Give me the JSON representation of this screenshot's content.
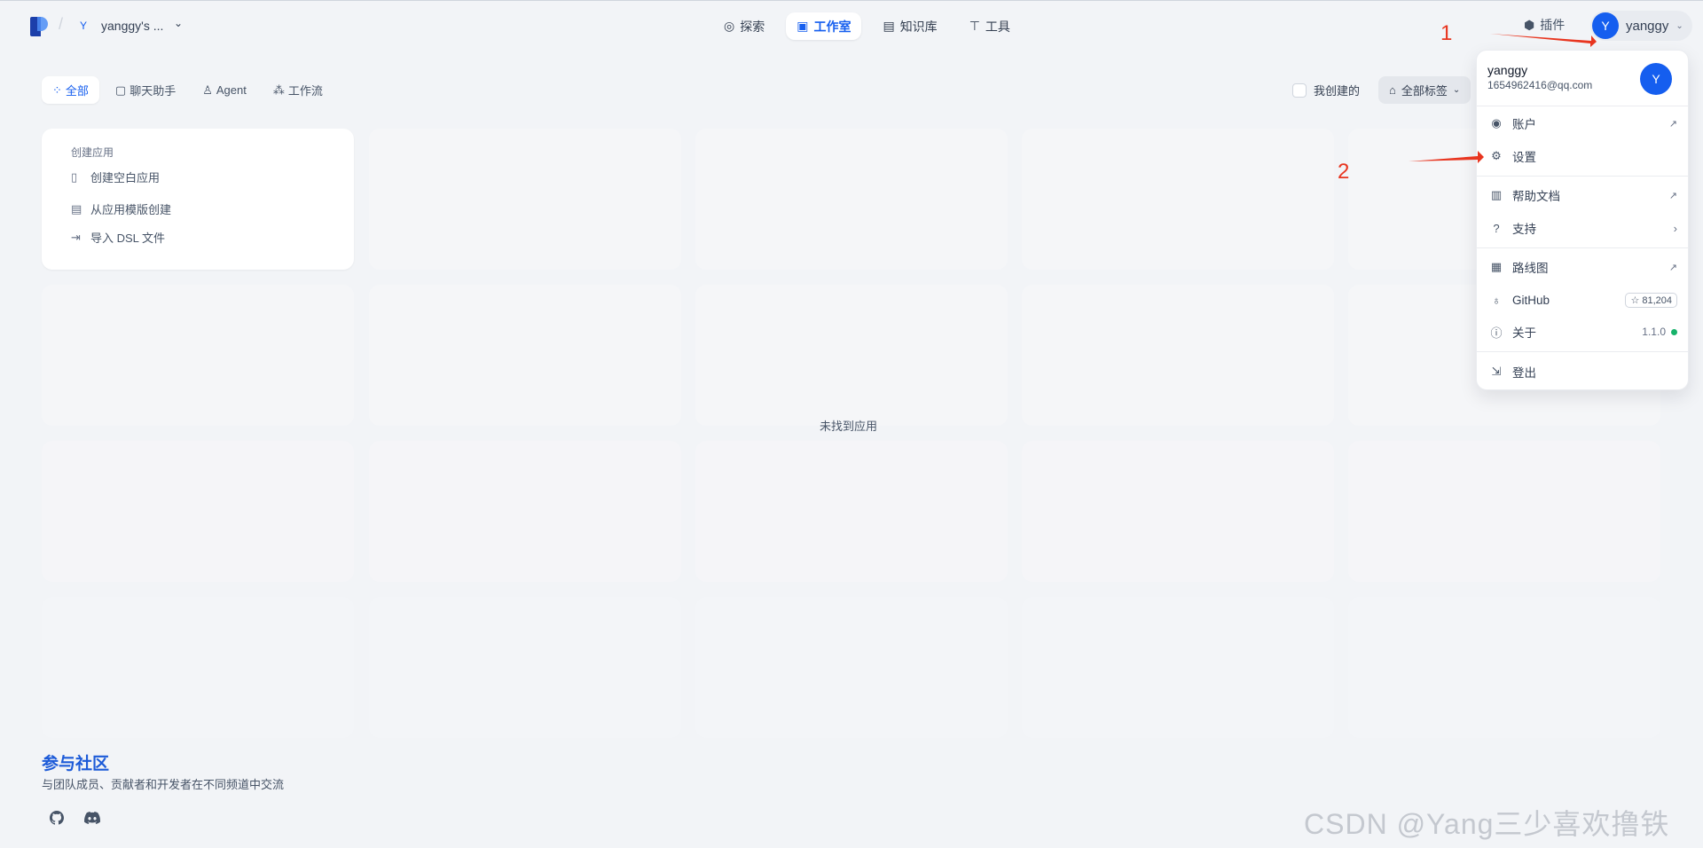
{
  "workspace": {
    "avatar": "Y",
    "name": "yanggy's ..."
  },
  "nav": {
    "explore": "探索",
    "studio": "工作室",
    "knowledge": "知识库",
    "tools": "工具"
  },
  "header_right": {
    "plugins": "插件",
    "user_avatar": "Y",
    "username": "yanggy"
  },
  "filters": {
    "tabs": [
      "全部",
      "聊天助手",
      "Agent",
      "工作流"
    ],
    "mine_label": "我创建的",
    "tags_label": "全部标签"
  },
  "create": {
    "title": "创建应用",
    "blank": "创建空白应用",
    "template": "从应用模版创建",
    "dsl": "导入 DSL 文件"
  },
  "empty_text": "未找到应用",
  "community": {
    "title": "参与社区",
    "desc": "与团队成员、贡献者和开发者在不同频道中交流"
  },
  "menu": {
    "name": "yanggy",
    "email": "1654962416@qq.com",
    "avatar": "Y",
    "account": "账户",
    "settings": "设置",
    "help_docs": "帮助文档",
    "support": "支持",
    "roadmap": "路线图",
    "github": "GitHub",
    "github_stars": "☆ 81,204",
    "about": "关于",
    "version": "1.1.0",
    "logout": "登出"
  },
  "annotations": {
    "one": "1",
    "two": "2"
  },
  "watermark": "CSDN @Yang三少喜欢撸铁",
  "colors": {
    "primary": "#155eef",
    "annotation": "#e8351f",
    "status_ok": "#17b26a"
  }
}
